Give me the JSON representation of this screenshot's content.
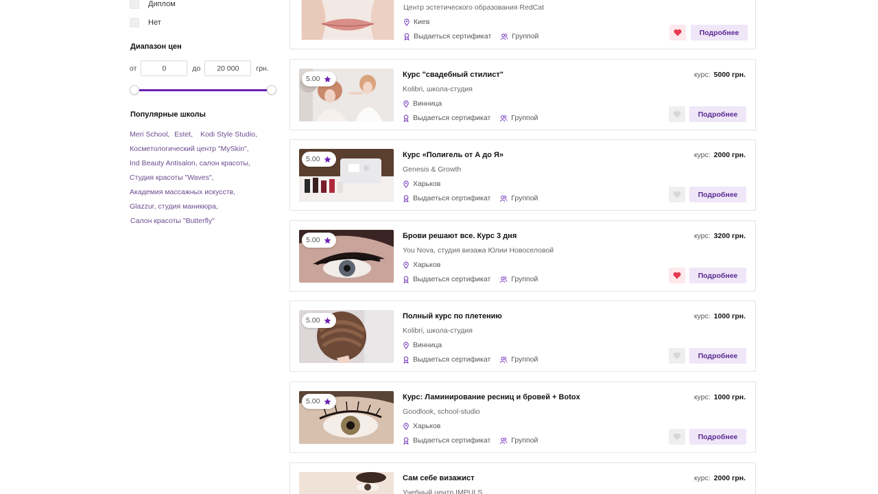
{
  "colors": {
    "accent": "#6a1fb0",
    "link": "#6b4c8f",
    "button_bg": "#efe6f8",
    "heart_active": "#e8384f",
    "heart_inactive": "#d7d7d7"
  },
  "filters": {
    "checkboxes": [
      {
        "label": "Диплом",
        "checked": false
      },
      {
        "label": "Нет",
        "checked": false
      }
    ],
    "price": {
      "heading": "Диапазон цен",
      "from_label": "от",
      "from_value": "0",
      "to_label": "до",
      "to_value": "20 000",
      "currency": "грн."
    },
    "schools": {
      "heading": "Популярные школы",
      "lines": [
        [
          "Meri School,",
          "Estet,",
          "Kodi Style Studio,"
        ],
        [
          "Косметологический центр \"MySkin\","
        ],
        [
          "Ind Beauty Antisalon, салон красоты,"
        ],
        [
          "Студия красоты \"Waves\","
        ],
        [
          "Академия массажных искусств,"
        ],
        [
          "Glazzur, студия маникюра,"
        ],
        [
          "Салон красоты \"Butterfly\""
        ]
      ]
    }
  },
  "courses": [
    {
      "title": "",
      "school": "Центр эстетического образования RedCat",
      "city": "Киев",
      "certificate": "Выдаеться сертификат",
      "format": "Группой",
      "price_label": "",
      "price": "",
      "rating": "",
      "favorite": true,
      "more_label": "Подробнее",
      "image": "lips-icon"
    },
    {
      "title": "Курс \"свадебный стилист\"",
      "school": "Kolibri, школа-студия",
      "city": "Винница",
      "certificate": "Выдаеться сертификат",
      "format": "Группой",
      "price_label": "курс:",
      "price": "5000 грн.",
      "rating": "5.00",
      "favorite": false,
      "more_label": "Подробнее",
      "image": "stylist-icon"
    },
    {
      "title": "Курс «Полигель от А до Я»",
      "school": "Genesis & Growth",
      "city": "Харьков",
      "certificate": "Выдаеться сертификат",
      "format": "Группой",
      "price_label": "курс:",
      "price": "2000 грн.",
      "rating": "5.00",
      "favorite": false,
      "more_label": "Подробнее",
      "image": "manicure-icon"
    },
    {
      "title": "Брови решают все. Курс 3 дня",
      "school": "You Nova, студия визажа Юлии Новоселовой",
      "city": "Харьков",
      "certificate": "Выдаеться сертификат",
      "format": "Группой",
      "price_label": "курс:",
      "price": "3200 грн.",
      "rating": "5.00",
      "favorite": true,
      "more_label": "Подробнее",
      "image": "eye-makeup-icon"
    },
    {
      "title": "Полный курс по плетению",
      "school": "Kolibri, школа-студия",
      "city": "Винница",
      "certificate": "Выдаеться сертификат",
      "format": "Группой",
      "price_label": "курс:",
      "price": "1000 грн.",
      "rating": "5.00",
      "favorite": false,
      "more_label": "Подробнее",
      "image": "braid-icon"
    },
    {
      "title": "Курс: Ламинирование ресниц и бровей + Botox",
      "school": "Goodlook, school-studio",
      "city": "Харьков",
      "certificate": "Выдаеться сертификат",
      "format": "Группой",
      "price_label": "курс:",
      "price": "1000 грн.",
      "rating": "5.00",
      "favorite": false,
      "more_label": "Подробнее",
      "image": "lashes-icon"
    },
    {
      "title": "Сам себе визажист",
      "school": "Учебный центр IMPULS",
      "city": "",
      "certificate": "",
      "format": "",
      "price_label": "курс:",
      "price": "2000 грн.",
      "rating": "",
      "favorite": false,
      "more_label": "",
      "image": "makeup-icon"
    }
  ]
}
